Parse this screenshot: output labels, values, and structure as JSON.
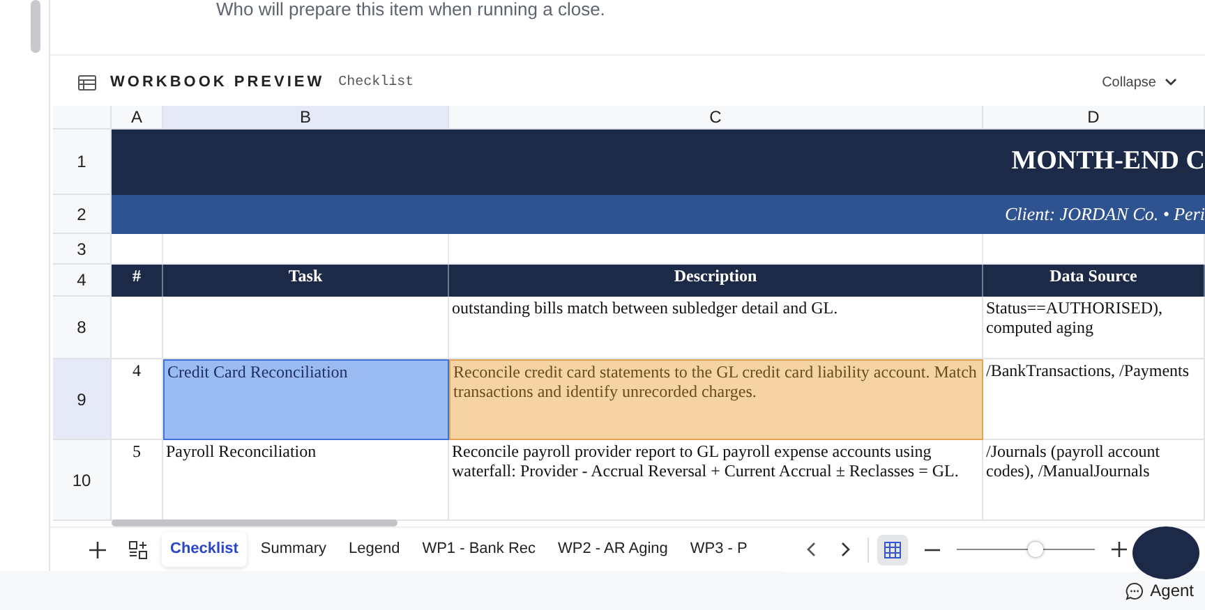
{
  "intro_text": "Who will prepare this item when running a close.",
  "preview": {
    "title": "WORKBOOK PREVIEW",
    "subtitle": "Checklist",
    "collapse_label": "Collapse"
  },
  "sheet": {
    "columns": [
      {
        "label": "A",
        "selected": false
      },
      {
        "label": "B",
        "selected": true
      },
      {
        "label": "C",
        "selected": false
      },
      {
        "label": "D",
        "selected": false
      }
    ],
    "rows": [
      {
        "number": "1",
        "kind": "title",
        "text": "MONTH-END C"
      },
      {
        "number": "2",
        "kind": "subtitle",
        "text": "Client: JORDAN Co. • Peri"
      },
      {
        "number": "3",
        "kind": "blank"
      },
      {
        "number": "4",
        "kind": "header",
        "index": "#",
        "task": "Task",
        "description": "Description",
        "source": "Data Source"
      },
      {
        "number": "8",
        "kind": "task",
        "selected": false,
        "description": "outstanding bills match between subledger detail and GL.",
        "source": "Status==AUTHORISED), computed aging"
      },
      {
        "number": "9",
        "kind": "task",
        "selected": true,
        "index": "4",
        "task": "Credit Card Reconciliation",
        "description": "Reconcile credit card statements to the GL credit card liability account. Match transactions and identify unrecorded charges.",
        "source": "/BankTransactions, /Payments"
      },
      {
        "number": "10",
        "kind": "task",
        "selected": false,
        "index": "5",
        "task": "Payroll Reconciliation",
        "description": "Reconcile payroll provider report to GL payroll expense accounts using waterfall: Provider - Accrual Reversal + Current Accrual ± Reclasses = GL.",
        "source": "/Journals (payroll account codes), /ManualJournals"
      }
    ]
  },
  "tabs": [
    {
      "label": "Checklist",
      "selected": true
    },
    {
      "label": "Summary",
      "selected": false
    },
    {
      "label": "Legend",
      "selected": false
    },
    {
      "label": "WP1 - Bank Rec",
      "selected": false
    },
    {
      "label": "WP2 - AR Aging",
      "selected": false
    },
    {
      "label": "WP3 - P",
      "selected": false
    }
  ],
  "zoom": {
    "grid_on": true,
    "level": 0.53
  },
  "agent_label": "Agent"
}
